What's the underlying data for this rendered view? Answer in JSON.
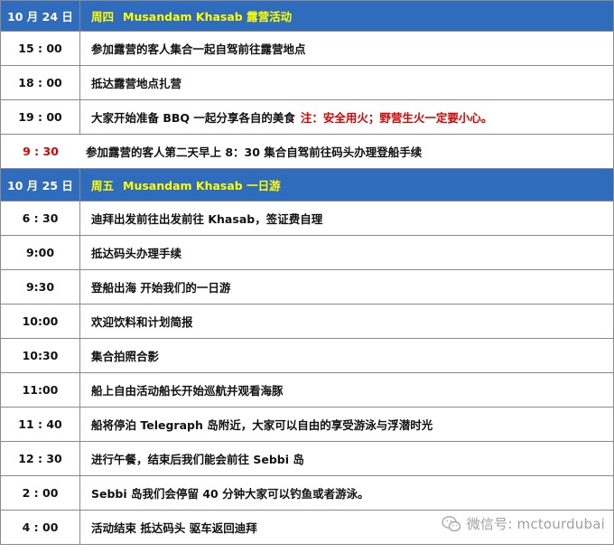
{
  "day1": {
    "date": "10 月 24 日",
    "weekday": "周四",
    "title": "Musandam Khasab 露营活动"
  },
  "day1_items": [
    {
      "time": "15 : 00",
      "desc": "参加露营的客人集合一起自驾前往露营地点"
    },
    {
      "time": "18 : 00",
      "desc": "抵达露营地点扎营"
    },
    {
      "time": "19 : 00",
      "desc": "大家开始准备 BBQ 一起分享各自的美食",
      "note": "注：安全用火；野营生火一定要小心。"
    }
  ],
  "notice": {
    "time": "9 : 30",
    "desc": "参加露营的客人第二天早上 8：30 集合自驾前往码头办理登船手续"
  },
  "day2": {
    "date": "10 月 25 日",
    "weekday": "周五",
    "title": "Musandam Khasab 一日游"
  },
  "day2_items": [
    {
      "time": "6 : 30",
      "desc": "迪拜出发前往出发前往 Khasab，签证费自理"
    },
    {
      "time": "9:00",
      "desc": "抵达码头办理手续"
    },
    {
      "time": "9:30",
      "desc": "登船出海  开始我们的一日游"
    },
    {
      "time": "10:00",
      "desc": "欢迎饮料和计划简报"
    },
    {
      "time": "10:30",
      "desc": "集合拍照合影"
    },
    {
      "time": "11:00",
      "desc": "船上自由活动船长开始巡航并观看海豚"
    },
    {
      "time": "11 : 40",
      "desc": " 船将停泊 Telegraph  岛附近，大家可以自由的享受游泳与浮潜时光"
    },
    {
      "time": "12 : 30",
      "desc": "进行午餐，结束后我们能会前往 Sebbi 岛"
    },
    {
      "time": "2 : 00",
      "desc": "Sebbi 岛我们会停留 40 分钟大家可以钓鱼或者游泳。"
    },
    {
      "time": "4 : 00",
      "desc": "活动结束  抵达码头  驱车返回迪拜"
    }
  ],
  "watermark": {
    "text": "微信号: mctourdubai",
    "icon": "wechat-icon"
  },
  "colors": {
    "header_bg": "#2f6cbd",
    "header_title": "#ffff00",
    "note_red": "#e00000"
  }
}
